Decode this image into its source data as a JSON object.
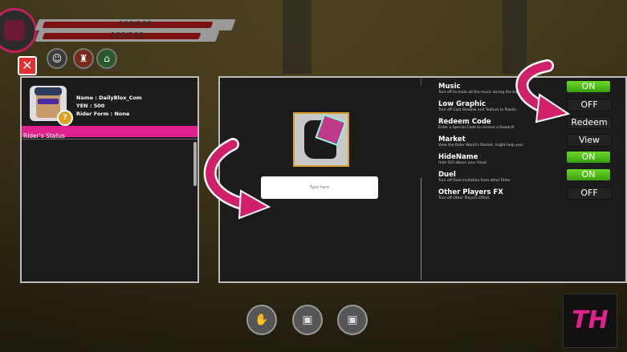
{
  "hud": {
    "hp_text": "100/100",
    "energy_text": "100/100"
  },
  "profile": {
    "name": "Name : DailyBlox_Com",
    "yen": "YEN : 500",
    "rider_form": "Rider Form : None",
    "status_label": "Rider's Status"
  },
  "redeem": {
    "placeholder": "Type here"
  },
  "settings": [
    {
      "name": "Music",
      "desc": "Turn off to mute all the music during the battle",
      "button": "ON",
      "state": "on"
    },
    {
      "name": "Low Graphic",
      "desc": "Turn off Cast Shadow and Texture to Plastic.",
      "button": "OFF",
      "state": "off"
    },
    {
      "name": "Redeem Code",
      "desc": "Enter a Special Code to receive a Reward!",
      "button": "Redeem",
      "state": "off"
    },
    {
      "name": "Market",
      "desc": "View the Rider World's Market, might help you!",
      "button": "View",
      "state": "off"
    },
    {
      "name": "HideName",
      "desc": "Hide GUI above your Head",
      "button": "ON",
      "state": "on"
    },
    {
      "name": "Duel",
      "desc": "Turn off Duel invitation from other Rider.",
      "button": "ON",
      "state": "on"
    },
    {
      "name": "Other Players FX",
      "desc": "Turn off Other Players Effect.",
      "button": "OFF",
      "state": "off"
    }
  ],
  "logo": {
    "text": "TH"
  },
  "colors": {
    "accent": "#e0208c",
    "on": "#4cbc18",
    "close": "#e03030"
  },
  "icons": [
    "close-icon",
    "avatar-icon",
    "shop-icon",
    "home-icon",
    "hand-icon",
    "backpack-icon"
  ]
}
